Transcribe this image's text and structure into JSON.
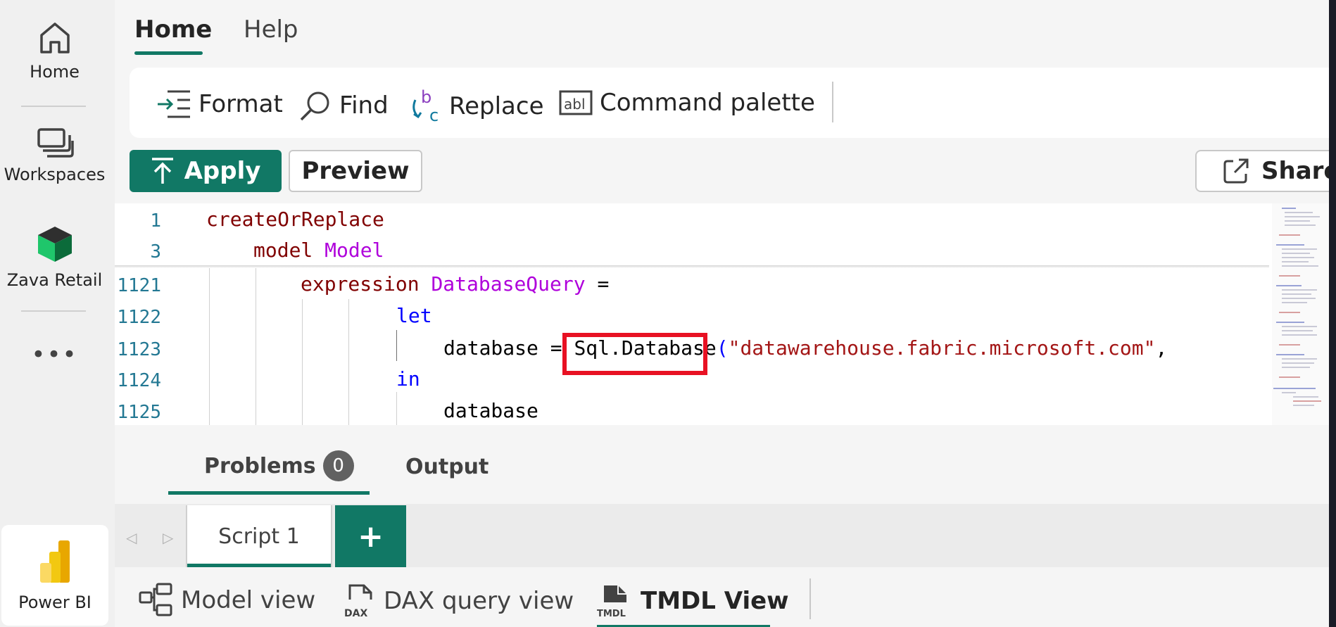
{
  "rail": {
    "home": "Home",
    "workspaces": "Workspaces",
    "workspace_name": "Zava Retail",
    "more": "•••",
    "brand": "Power BI"
  },
  "tabs": {
    "home": "Home",
    "help": "Help"
  },
  "toolbar": {
    "format": "Format",
    "find": "Find",
    "replace": "Replace",
    "command_palette": "Command palette"
  },
  "actions": {
    "apply": "Apply",
    "preview": "Preview",
    "share": "Share"
  },
  "editor": {
    "lines": [
      {
        "num": "1",
        "parts": [
          {
            "t": "createOrReplace",
            "c": "kw-maroon2"
          }
        ]
      },
      {
        "num": "3",
        "parts": [
          {
            "t": "model ",
            "c": "kw-maroon2"
          },
          {
            "t": "Model",
            "c": "kw-purple"
          }
        ]
      },
      {
        "num": "1121",
        "parts": [
          {
            "t": "expression ",
            "c": "kw-maroon2"
          },
          {
            "t": "DatabaseQuery",
            "c": "kw-purple"
          },
          {
            "t": " =",
            "c": ""
          }
        ]
      },
      {
        "num": "1122",
        "parts": [
          {
            "t": "let",
            "c": "kw-blue"
          }
        ]
      },
      {
        "num": "1123",
        "parts": [
          {
            "t": "database = ",
            "c": ""
          },
          {
            "t": "Sql.Database",
            "c": ""
          },
          {
            "t": "(",
            "c": "kw-blue"
          },
          {
            "t": "\"datawarehouse.fabric.microsoft.com\"",
            "c": "str"
          },
          {
            "t": ",",
            "c": ""
          }
        ]
      },
      {
        "num": "1124",
        "parts": [
          {
            "t": "in",
            "c": "kw-blue"
          }
        ]
      },
      {
        "num": "1125",
        "parts": [
          {
            "t": "database",
            "c": ""
          }
        ]
      }
    ]
  },
  "panel": {
    "problems": "Problems",
    "problems_count": "0",
    "output": "Output"
  },
  "scripts": {
    "tab": "Script 1",
    "add": "+"
  },
  "views": {
    "model": "Model view",
    "dax": "DAX query view",
    "tmdl": "TMDL View"
  },
  "colors": {
    "accent": "#117865",
    "highlight": "#e81123"
  }
}
